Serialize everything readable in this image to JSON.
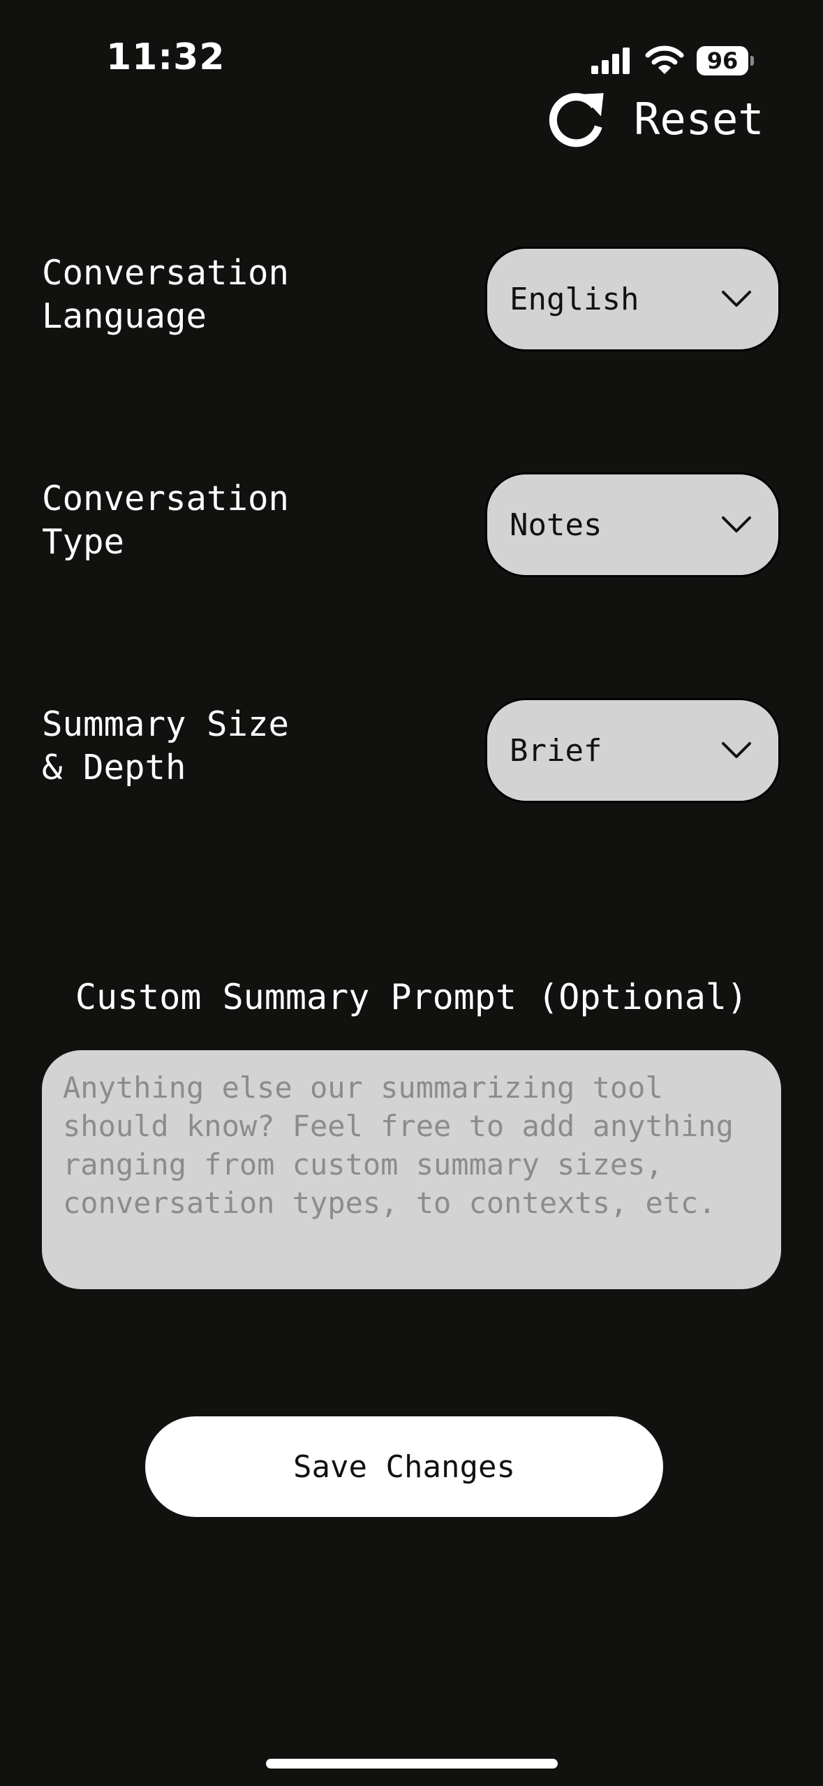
{
  "status_bar": {
    "time": "11:32",
    "battery_level": "96",
    "signal_icon": "cellular-signal-icon",
    "wifi_icon": "wifi-icon"
  },
  "header": {
    "reset_label": "Reset",
    "reset_icon": "refresh-icon"
  },
  "settings": [
    {
      "label": "Conversation\nLanguage",
      "value": "English"
    },
    {
      "label": "Conversation\nType",
      "value": "Notes"
    },
    {
      "label": "Summary Size\n& Depth",
      "value": "Brief"
    }
  ],
  "custom_prompt": {
    "title": "Custom Summary Prompt (Optional)",
    "placeholder": "Anything else our summarizing tool should know? Feel free to add anything ranging from custom summary sizes, conversation types, to contexts, etc.",
    "value": ""
  },
  "save_button_label": "Save Changes",
  "colors": {
    "background": "#11120f",
    "field_background": "#d3d3d3",
    "text_light": "#ffffff",
    "placeholder": "#8c8c8c"
  }
}
